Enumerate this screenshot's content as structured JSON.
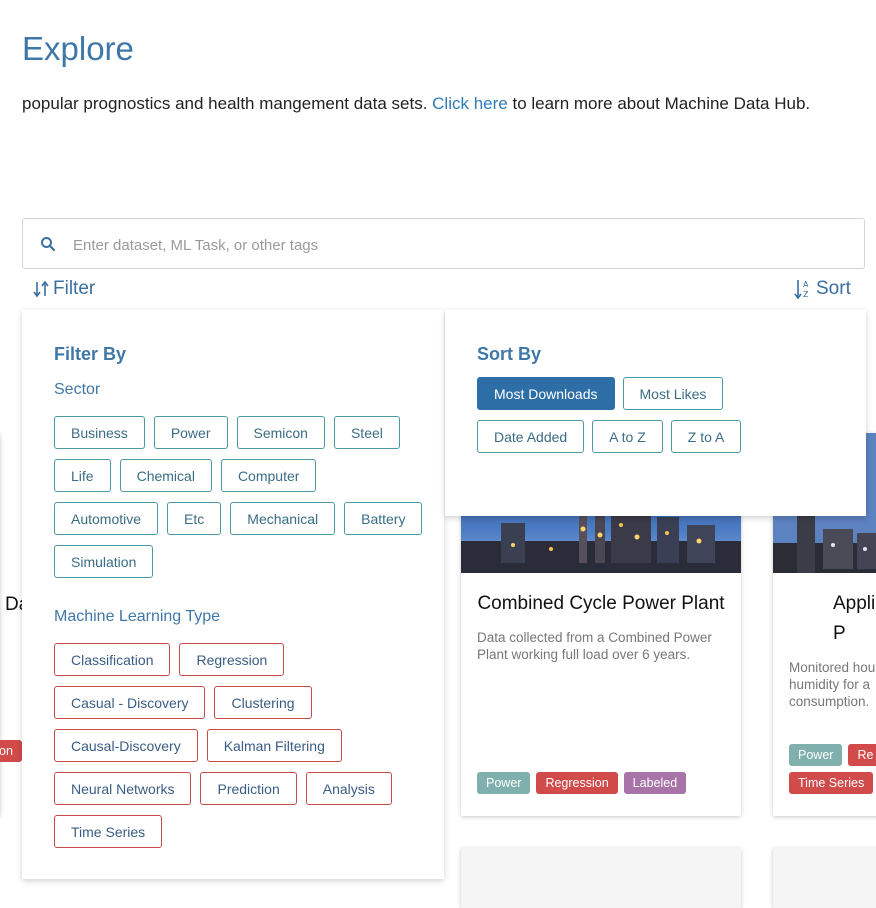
{
  "header": {
    "title": "Explore",
    "intro_before": "popular prognostics and health mangement data sets. ",
    "intro_link": "Click here",
    "intro_after": " to learn more about Machine Data Hub."
  },
  "search": {
    "placeholder": "Enter dataset, ML Task, or other tags"
  },
  "toolbar": {
    "filter_label": "Filter",
    "sort_label": "Sort"
  },
  "filter_panel": {
    "heading": "Filter By",
    "sector_heading": "Sector",
    "sectors": [
      "Business",
      "Power",
      "Semicon",
      "Steel",
      "Life",
      "Chemical",
      "Computer",
      "Automotive",
      "Etc",
      "Mechanical",
      "Battery",
      "Simulation"
    ],
    "ml_heading": "Machine Learning Type",
    "ml_types": [
      "Classification",
      "Regression",
      "Casual - Discovery",
      "Clustering",
      "Causal-Discovery",
      "Kalman Filtering",
      "Neural Networks",
      "Prediction",
      "Analysis",
      "Time Series"
    ]
  },
  "sort_panel": {
    "heading": "Sort By",
    "options": [
      "Most Downloads",
      "Most Likes",
      "Date Added",
      "A to Z",
      "Z to A"
    ],
    "selected": "Most Downloads"
  },
  "cards": [
    {
      "title": "Combined Cycle Power Plant",
      "description": "Data collected from a Combined Power Plant working full load over 6 years.",
      "tags": [
        {
          "label": "Power",
          "color": "#7fb0ad"
        },
        {
          "label": "Regression",
          "color": "#d24b4b"
        },
        {
          "label": "Labeled",
          "color": "#a874a8"
        }
      ]
    },
    {
      "title_partial": "Appli\nP",
      "description_partial": "Monitored hou\nhumidity for a\nconsumption.",
      "tags": [
        {
          "label": "Power",
          "color": "#7fb0ad"
        },
        {
          "label": "Re",
          "color": "#d24b4b"
        },
        {
          "label": "Time Series",
          "color": "#d24b4b"
        }
      ]
    },
    {
      "title_partial": "Da",
      "tags": [
        {
          "label": "on",
          "color": "#d24b4b"
        }
      ]
    }
  ],
  "colors": {
    "accent": "#3f78a8",
    "selected_sort": "#2e6ea6",
    "sector_chip_border": "#4a9aa6",
    "ml_chip_border": "#c94a4a"
  }
}
